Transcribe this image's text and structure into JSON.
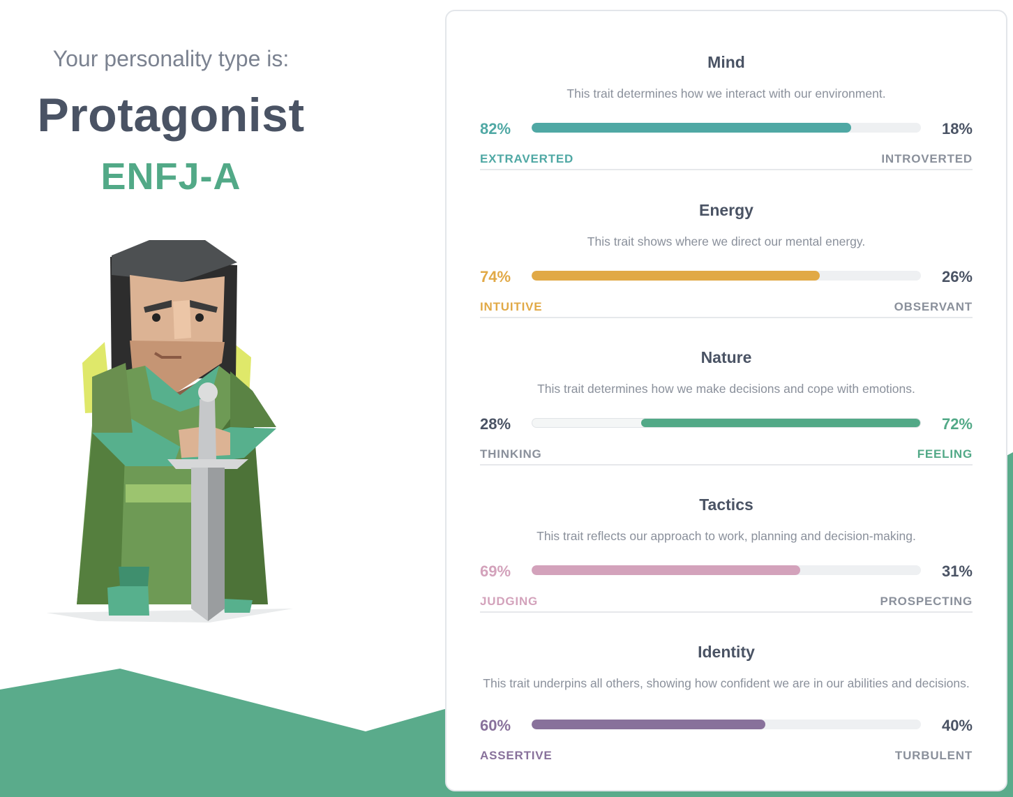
{
  "header": {
    "intro": "Your personality type is:",
    "type_name": "Protagonist",
    "type_code": "ENFJ-A"
  },
  "colors": {
    "teal": "#4fa8a4",
    "yellow": "#e1a946",
    "green": "#52a987",
    "pink": "#d3a2bb",
    "purple": "#88719b",
    "neutral_text": "#4a5364",
    "label_gray": "#8a909b",
    "hill": "#5aab8b"
  },
  "traits": [
    {
      "title": "Mind",
      "description": "This trait determines how we interact with our environment.",
      "left_percent": "82%",
      "right_percent": "18%",
      "left_label": "EXTRAVERTED",
      "right_label": "INTROVERTED",
      "dominant": "left",
      "dominant_fraction": 0.82,
      "color": "#4fa8a4"
    },
    {
      "title": "Energy",
      "description": "This trait shows where we direct our mental energy.",
      "left_percent": "74%",
      "right_percent": "26%",
      "left_label": "INTUITIVE",
      "right_label": "OBSERVANT",
      "dominant": "left",
      "dominant_fraction": 0.74,
      "color": "#e1a946"
    },
    {
      "title": "Nature",
      "description": "This trait determines how we make decisions and cope with emotions.",
      "left_percent": "28%",
      "right_percent": "72%",
      "left_label": "THINKING",
      "right_label": "FEELING",
      "dominant": "right",
      "dominant_fraction": 0.72,
      "color": "#52a987"
    },
    {
      "title": "Tactics",
      "description": "This trait reflects our approach to work, planning and decision-making.",
      "left_percent": "69%",
      "right_percent": "31%",
      "left_label": "JUDGING",
      "right_label": "PROSPECTING",
      "dominant": "left",
      "dominant_fraction": 0.69,
      "color": "#d3a2bb"
    },
    {
      "title": "Identity",
      "description": "This trait underpins all others, showing how confident we are in our abilities and decisions.",
      "left_percent": "60%",
      "right_percent": "40%",
      "left_label": "ASSERTIVE",
      "right_label": "TURBULENT",
      "dominant": "left",
      "dominant_fraction": 0.6,
      "color": "#88719b"
    }
  ]
}
